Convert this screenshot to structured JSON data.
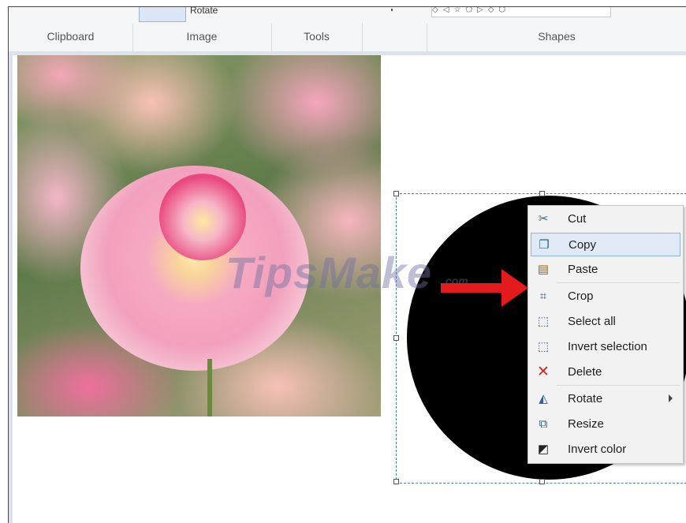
{
  "ribbon": {
    "top_rotate_label": "Rotate",
    "groups": [
      "Clipboard",
      "Image",
      "Tools",
      "",
      "Shapes"
    ]
  },
  "watermark": {
    "text": "TipsMake",
    "suffix": ".com"
  },
  "context_menu": {
    "items": [
      {
        "label": "Cut",
        "icon": "scissors-icon"
      },
      {
        "label": "Copy",
        "icon": "copy-icon",
        "highlighted": true
      },
      {
        "label": "Paste",
        "icon": "paste-icon"
      },
      {
        "label": "Crop",
        "icon": "crop-icon"
      },
      {
        "label": "Select all",
        "icon": "select-all-icon"
      },
      {
        "label": "Invert selection",
        "icon": "invert-selection-icon"
      },
      {
        "label": "Delete",
        "icon": "delete-x-icon"
      },
      {
        "label": "Rotate",
        "icon": "rotate-icon",
        "submenu": true
      },
      {
        "label": "Resize",
        "icon": "resize-icon"
      },
      {
        "label": "Invert color",
        "icon": "invert-color-icon"
      }
    ]
  },
  "colors": {
    "accent_arrow": "#e41a1c",
    "menu_highlight": "#dfeaf6",
    "selection_border": "#4a7fb5"
  }
}
